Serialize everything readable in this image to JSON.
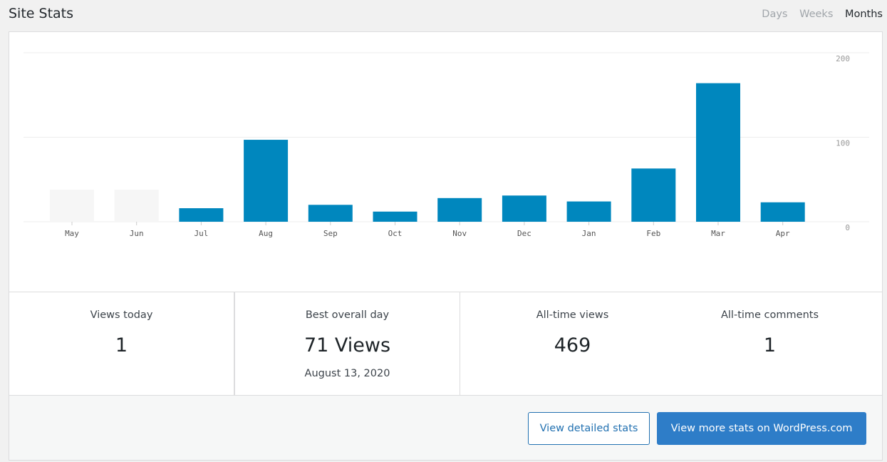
{
  "header": {
    "title": "Site Stats",
    "periods": [
      "Days",
      "Weeks",
      "Months"
    ],
    "active_period": "Months"
  },
  "chart_data": {
    "type": "bar",
    "categories": [
      "May",
      "Jun",
      "Jul",
      "Aug",
      "Sep",
      "Oct",
      "Nov",
      "Dec",
      "Jan",
      "Feb",
      "Mar",
      "Apr"
    ],
    "values": [
      0,
      0,
      16,
      97,
      20,
      12,
      28,
      31,
      24,
      63,
      164,
      23
    ],
    "placeholder_categories": [
      "May",
      "Jun"
    ],
    "y_ticks": [
      "200",
      "100",
      "0"
    ],
    "ylim": [
      0,
      200
    ],
    "bar_color": "#0087be",
    "placeholder_color": "#f6f6f6",
    "grid": true
  },
  "stats": {
    "views_today": {
      "label": "Views today",
      "value": "1"
    },
    "best_day": {
      "label": "Best overall day",
      "value": "71 Views",
      "date": "August 13, 2020"
    },
    "all_time_views": {
      "label": "All-time views",
      "value": "469"
    },
    "all_time_comments": {
      "label": "All-time comments",
      "value": "1"
    }
  },
  "footer": {
    "detailed_label": "View detailed stats",
    "wpcom_label": "View more stats on WordPress.com"
  }
}
